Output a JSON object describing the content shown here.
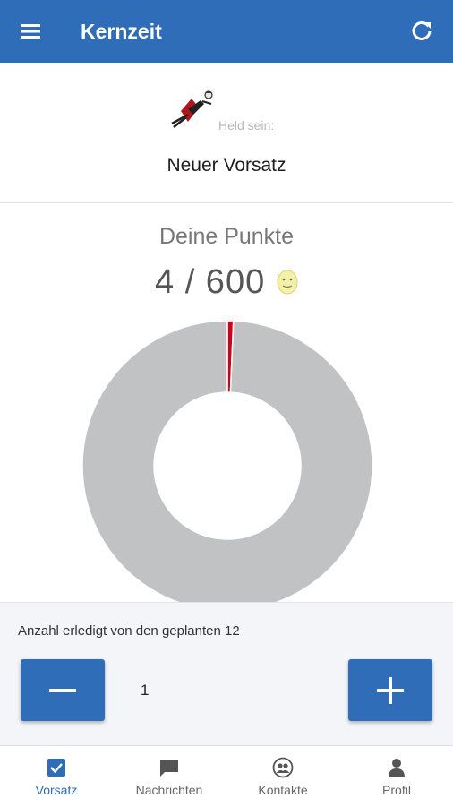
{
  "appbar": {
    "title": "Kernzeit",
    "menu_icon": "hamburger-menu-icon",
    "refresh_icon": "refresh-icon",
    "color": "#2f6db8"
  },
  "hero": {
    "icon": "flying-hero-icon",
    "subtitle": "Held sein:",
    "title": "Neuer Vorsatz"
  },
  "points": {
    "label": "Deine Punkte",
    "value_text": "4 / 600",
    "current": 4,
    "max": 600,
    "icon": "smiley-icon"
  },
  "chart_data": {
    "type": "pie",
    "style": "donut",
    "slices": [
      {
        "value": 4,
        "color": "#d0021b"
      },
      {
        "value": 596,
        "color": "#c1c2c3"
      }
    ]
  },
  "counter": {
    "label": "Anzahl erledigt von den geplanten 12",
    "value": "1",
    "minus_icon": "minus-icon",
    "plus_icon": "plus-icon"
  },
  "nav": {
    "items": [
      {
        "label": "Vorsatz",
        "icon": "checkbox-icon",
        "active": true
      },
      {
        "label": "Nachrichten",
        "icon": "chat-bubble-icon",
        "active": false
      },
      {
        "label": "Kontakte",
        "icon": "contacts-icon",
        "active": false
      },
      {
        "label": "Profil",
        "icon": "person-icon",
        "active": false
      }
    ],
    "active_color": "#2f6db8"
  }
}
